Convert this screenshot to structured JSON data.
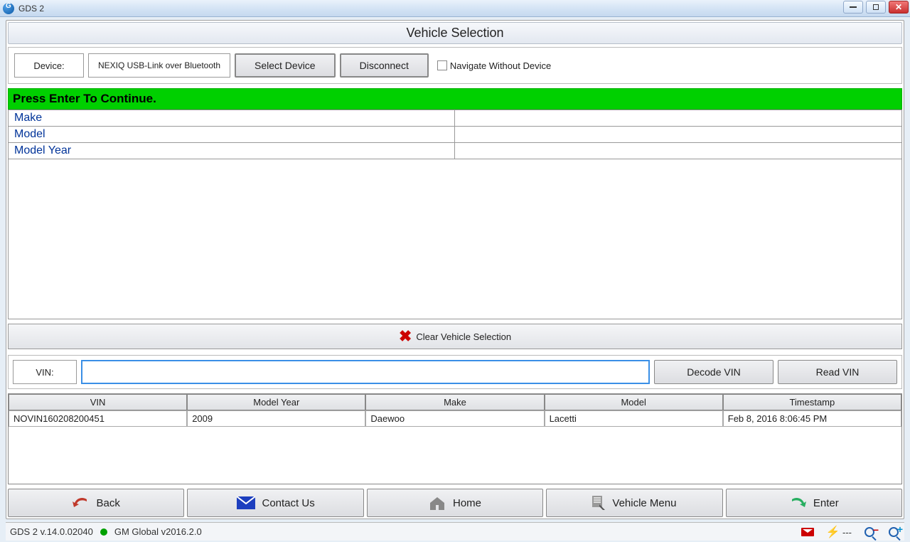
{
  "window": {
    "title": "GDS 2"
  },
  "page_title": "Vehicle Selection",
  "device_row": {
    "label": "Device:",
    "device_name": "NEXIQ USB-Link over Bluetooth",
    "select_btn": "Select Device",
    "disconnect_btn": "Disconnect",
    "navigate_without": "Navigate Without Device"
  },
  "green_message": "Press Enter To Continue.",
  "selection": {
    "rows": [
      {
        "key": "Make",
        "value": ""
      },
      {
        "key": "Model",
        "value": ""
      },
      {
        "key": "Model Year",
        "value": ""
      }
    ]
  },
  "clear_btn": "Clear Vehicle Selection",
  "vin_row": {
    "label": "VIN:",
    "value": "",
    "decode_btn": "Decode VIN",
    "read_btn": "Read VIN"
  },
  "history_table": {
    "headers": [
      "VIN",
      "Model Year",
      "Make",
      "Model",
      "Timestamp"
    ],
    "rows": [
      {
        "vin": "NOVIN160208200451",
        "model_year": "2009",
        "make": "Daewoo",
        "model": "Lacetti",
        "timestamp": "Feb 8, 2016 8:06:45 PM"
      }
    ]
  },
  "nav": {
    "back": "Back",
    "contact": "Contact Us",
    "home": "Home",
    "vehicle_menu": "Vehicle Menu",
    "enter": "Enter"
  },
  "status": {
    "version": "GDS 2 v.14.0.02040",
    "status_indicator": "green",
    "global": "GM Global v2016.2.0",
    "connection_text": "---"
  }
}
